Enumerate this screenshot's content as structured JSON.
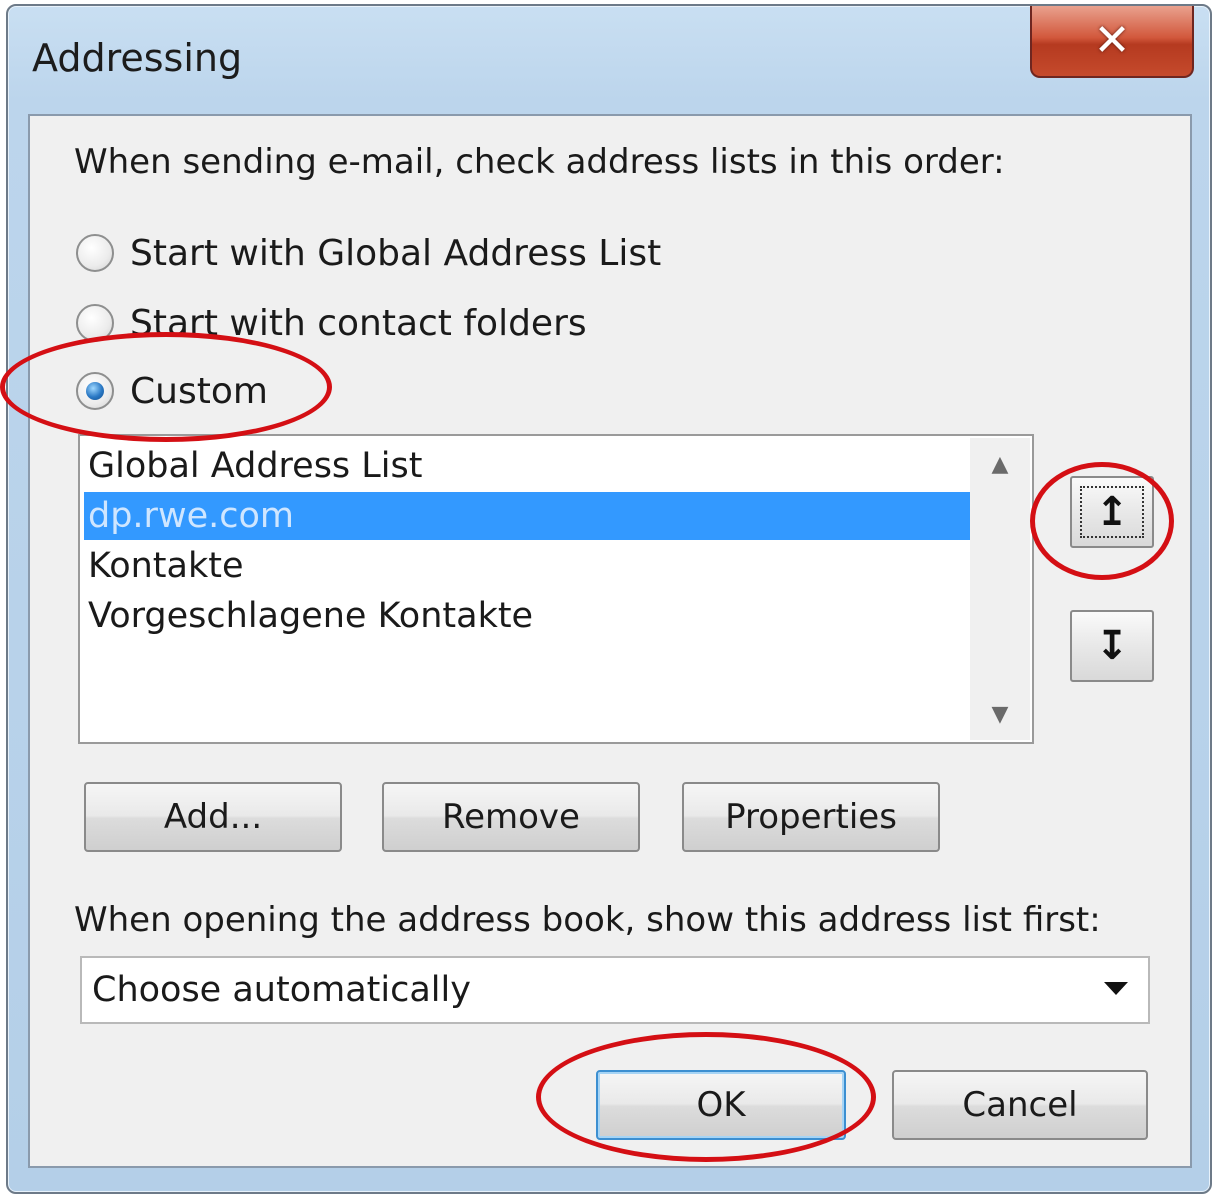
{
  "window": {
    "title": "Addressing",
    "close_label": "✕"
  },
  "order_section": {
    "prompt": "When sending e-mail, check address lists in this order:",
    "options": [
      {
        "label": "Start with Global Address List",
        "checked": false
      },
      {
        "label": "Start with contact folders",
        "checked": false
      },
      {
        "label": "Custom",
        "checked": true
      }
    ]
  },
  "address_lists": {
    "items": [
      {
        "label": "Global Address List",
        "selected": false
      },
      {
        "label": "dp.rwe.com",
        "selected": true
      },
      {
        "label": "Kontakte",
        "selected": false
      },
      {
        "label": "Vorgeschlagene Kontakte",
        "selected": false
      }
    ],
    "move_up_glyph": "↥",
    "move_down_glyph": "↧"
  },
  "list_buttons": {
    "add": "Add...",
    "remove": "Remove",
    "properties": "Properties"
  },
  "address_book_section": {
    "prompt": "When opening the address book, show this address list first:",
    "selected_value": "Choose automatically"
  },
  "dialog_buttons": {
    "ok": "OK",
    "cancel": "Cancel"
  },
  "colors": {
    "selection": "#3399ff",
    "annotation": "#d40f14"
  }
}
